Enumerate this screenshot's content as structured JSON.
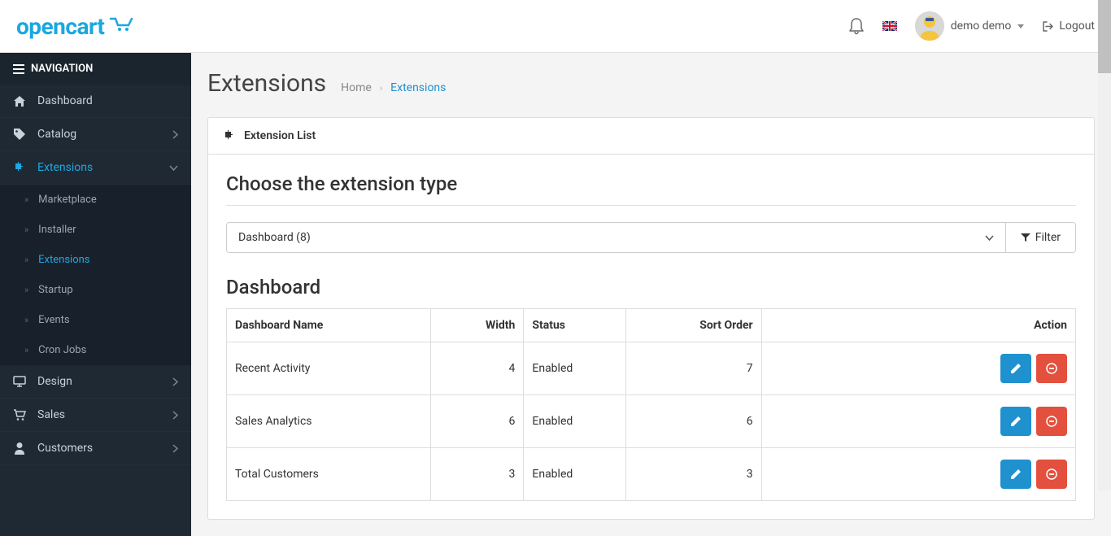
{
  "header": {
    "logo_text": "opencart",
    "user_name": "demo demo",
    "logout_label": "Logout"
  },
  "sidebar": {
    "heading": "NAVIGATION",
    "items": [
      {
        "label": "Dashboard",
        "expandable": false
      },
      {
        "label": "Catalog",
        "expandable": true
      },
      {
        "label": "Extensions",
        "expandable": true,
        "active": true
      },
      {
        "label": "Design",
        "expandable": true
      },
      {
        "label": "Sales",
        "expandable": true
      },
      {
        "label": "Customers",
        "expandable": true
      }
    ],
    "sub_items": [
      {
        "label": "Marketplace"
      },
      {
        "label": "Installer"
      },
      {
        "label": "Extensions",
        "active": true
      },
      {
        "label": "Startup"
      },
      {
        "label": "Events"
      },
      {
        "label": "Cron Jobs"
      }
    ]
  },
  "page": {
    "title": "Extensions",
    "breadcrumb_home": "Home",
    "breadcrumb_current": "Extensions",
    "panel_title": "Extension List",
    "section_choose": "Choose the extension type",
    "select_value": "Dashboard (8)",
    "filter_label": "Filter",
    "section_table": "Dashboard"
  },
  "table": {
    "headers": {
      "name": "Dashboard Name",
      "width": "Width",
      "status": "Status",
      "sort": "Sort Order",
      "action": "Action"
    },
    "rows": [
      {
        "name": "Recent Activity",
        "width": "4",
        "status": "Enabled",
        "sort": "7"
      },
      {
        "name": "Sales Analytics",
        "width": "6",
        "status": "Enabled",
        "sort": "6"
      },
      {
        "name": "Total Customers",
        "width": "3",
        "status": "Enabled",
        "sort": "3"
      }
    ]
  }
}
